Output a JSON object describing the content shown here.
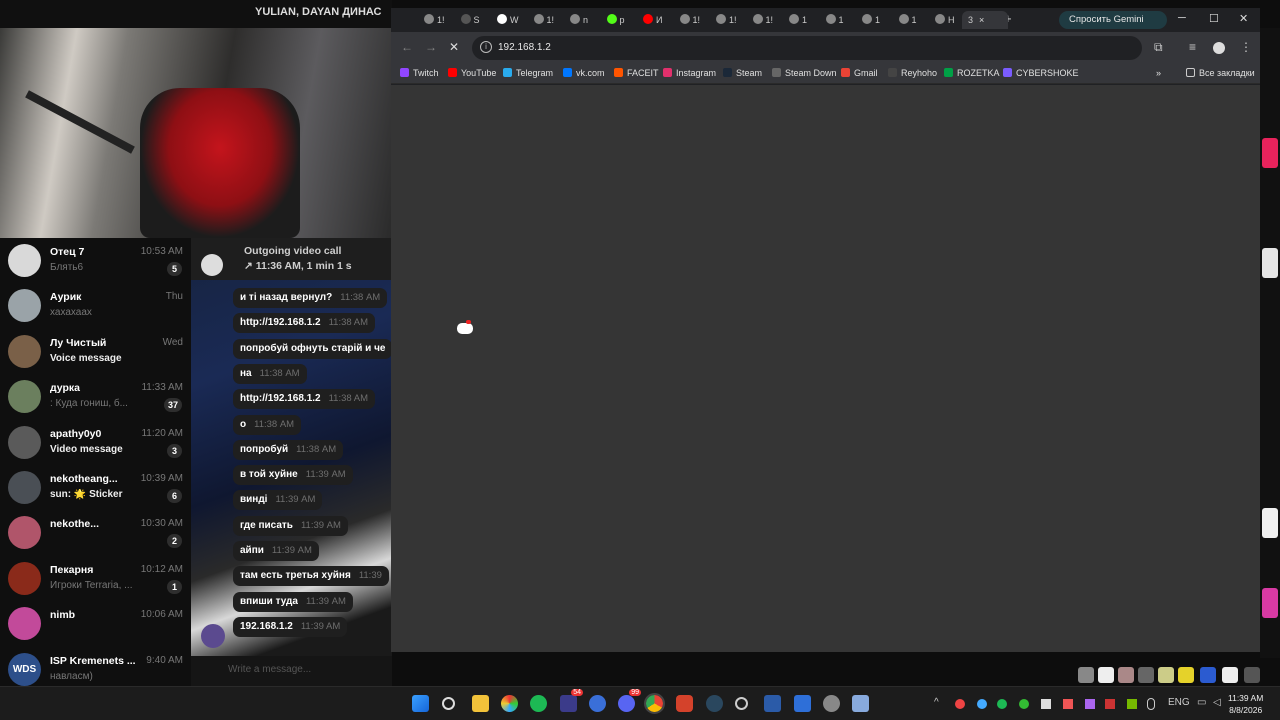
{
  "telegram": {
    "video_header_text": "YULIAN, DAYAN ДИНАС",
    "chats": [
      {
        "name": "Отец 7",
        "time": "10:53 AM",
        "preview": "Блять6",
        "preview_white": false,
        "badge": "5",
        "avatar_color": "#d9d9d9"
      },
      {
        "name": "Аурик",
        "time": "Thu",
        "preview": "хахахаах",
        "preview_white": false,
        "badge": "",
        "avatar_color": "#9aa3a8",
        "check": "✓✓"
      },
      {
        "name": "Лу Чистый",
        "time": "Wed",
        "preview": "Voice message",
        "preview_white": true,
        "badge": "",
        "avatar_color": "#7a6048",
        "check": "✓✓"
      },
      {
        "name": "дурка",
        "time": "11:33 AM",
        "preview": ": Куда гониш, б...",
        "preview_white": false,
        "badge": "37",
        "avatar_color": "#6b7f5e"
      },
      {
        "name": "apathy0y0",
        "time": "11:20 AM",
        "preview": "Video message",
        "preview_white": true,
        "badge": "3",
        "avatar_color": "#5a5a5a"
      },
      {
        "name": "nekotheang...",
        "time": "10:39 AM",
        "preview": "sun: 🌟 Sticker",
        "preview_white": true,
        "badge": "6",
        "avatar_color": "#4a4f55"
      },
      {
        "name": "nekothe...",
        "time": "10:30 AM",
        "preview": "",
        "preview_white": false,
        "badge": "2",
        "avatar_color": "#b0556a"
      },
      {
        "name": "Пекарня",
        "time": "10:12 AM",
        "preview": "Игроки Terraria, ...",
        "preview_white": false,
        "badge": "1",
        "avatar_color": "#8a2a1a"
      },
      {
        "name": "nimb",
        "time": "10:06 AM",
        "preview": "",
        "preview_white": false,
        "badge": "",
        "avatar_color": "#c24a9a"
      },
      {
        "name": "ISP Kremenets ...",
        "time": "9:40 AM",
        "preview": "навласм)",
        "preview_white": false,
        "badge": "",
        "avatar_color": "#2d4f8a",
        "avatar_text": "WDS"
      }
    ],
    "call": {
      "title": "Outgoing video call",
      "detail": "↗ 11:36 AM, 1 min 1 s"
    },
    "messages": [
      {
        "text": "и ті назад вернул?",
        "time": "11:38 AM"
      },
      {
        "text": "http://192.168.1.2",
        "time": "11:38 AM"
      },
      {
        "text": "попробуй офнуть старій и че",
        "time": ""
      },
      {
        "text": "на",
        "time": "11:38 AM"
      },
      {
        "text": "http://192.168.1.2",
        "time": "11:38 AM"
      },
      {
        "text": "о",
        "time": "11:38 AM"
      },
      {
        "text": "попробуй",
        "time": "11:38 AM"
      },
      {
        "text": "в той хуйне",
        "time": "11:39 AM"
      },
      {
        "text": "винді",
        "time": "11:39 AM"
      },
      {
        "text": "где писать",
        "time": "11:39 AM"
      },
      {
        "text": "айпи",
        "time": "11:39 AM"
      },
      {
        "text": "там есть третья хуйня",
        "time": "11:39"
      },
      {
        "text": "впиши туда",
        "time": "11:39 AM"
      },
      {
        "text": "192.168.1.2",
        "time": "11:39 AM"
      }
    ],
    "input_placeholder": "Write a message..."
  },
  "chrome": {
    "tabs": [
      {
        "label": "1!",
        "color": "#888"
      },
      {
        "label": "S",
        "color": "#555"
      },
      {
        "label": "W",
        "color": "#fff"
      },
      {
        "label": "1!",
        "color": "#888"
      },
      {
        "label": "n",
        "color": "#888"
      },
      {
        "label": "p",
        "color": "#53fc18"
      },
      {
        "label": "И",
        "color": "#ff0000"
      },
      {
        "label": "1!",
        "color": "#888"
      },
      {
        "label": "1!",
        "color": "#888"
      },
      {
        "label": "1!",
        "color": "#888"
      },
      {
        "label": "1",
        "color": "#888"
      },
      {
        "label": "1",
        "color": "#888"
      },
      {
        "label": "1",
        "color": "#888"
      },
      {
        "label": "1",
        "color": "#888"
      },
      {
        "label": "Н",
        "color": "#888"
      }
    ],
    "active_tab": {
      "label": "3",
      "close": "×"
    },
    "new_tab": "+",
    "gemini_label": "Спросить Gemini",
    "window_controls": {
      "minimize": "─",
      "maximize": "☐",
      "close": "✕"
    },
    "url": "192.168.1.2",
    "bookmarks": [
      {
        "label": "Twitch",
        "color": "#9146ff"
      },
      {
        "label": "YouTube",
        "color": "#ff0000"
      },
      {
        "label": "Telegram",
        "color": "#2aabee"
      },
      {
        "label": "vk.com",
        "color": "#0077ff"
      },
      {
        "label": "FACEIT",
        "color": "#ff5500"
      },
      {
        "label": "Instagram",
        "color": "#e1306c"
      },
      {
        "label": "Steam",
        "color": "#1b2838"
      },
      {
        "label": "Steam Down",
        "color": "#666"
      },
      {
        "label": "Gmail",
        "color": "#ea4335"
      },
      {
        "label": "Reyhoho",
        "color": "#444"
      },
      {
        "label": "ROZETKA",
        "color": "#00a046"
      },
      {
        "label": "CYBERSHOKE",
        "color": "#7a5cff"
      }
    ],
    "all_bookmarks": "Все закладки",
    "more_bookmarks": "»"
  },
  "taskbar": {
    "lang": "ENG",
    "time": "11:39 AM",
    "date": "8/8/2026",
    "badge_a": "54",
    "badge_b": "99"
  }
}
